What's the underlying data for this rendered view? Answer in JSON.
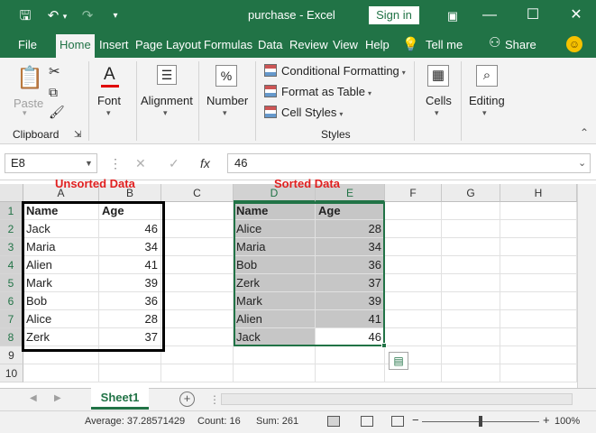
{
  "titlebar": {
    "title": "purchase  -  Excel",
    "sign_in": "Sign in",
    "icons": [
      "save-icon",
      "undo-icon",
      "redo-icon",
      "customize-icon",
      "ribbon-display-icon",
      "minimize-icon",
      "maximize-icon",
      "close-icon"
    ],
    "glyphs": {
      "save": "🖫",
      "undo": "↶",
      "undo_caret": "▾",
      "redo": "↷",
      "customize": "▾",
      "ribbon_display": "▣",
      "minimize": "—",
      "maximize": "☐",
      "close": "✕"
    }
  },
  "menu": {
    "tabs": [
      "File",
      "Home",
      "Insert",
      "Page Layout",
      "Formulas",
      "Data",
      "Review",
      "View",
      "Help"
    ],
    "active": "Home",
    "tell_me": "Tell me",
    "share": "Share",
    "glyphs": {
      "lightbulb": "💡",
      "person": "⚇",
      "smiley": "☺"
    }
  },
  "ribbon": {
    "clipboard": {
      "paste": "Paste",
      "label": "Clipboard",
      "glyphs": {
        "paste": "📋",
        "cut": "✂",
        "copy": "⧉",
        "painter": "🖌",
        "launcher": "⇲"
      }
    },
    "font": {
      "label": "Font",
      "glyph": "A"
    },
    "alignment": {
      "label": "Alignment",
      "glyph": "☰"
    },
    "number": {
      "label": "Number",
      "glyph": "%"
    },
    "styles": {
      "items": [
        "Conditional Formatting",
        "Format as Table",
        "Cell Styles"
      ],
      "label": "Styles"
    },
    "cells": {
      "label": "Cells",
      "glyph": "▦"
    },
    "editing": {
      "label": "Editing",
      "glyph": "⌕"
    },
    "collapse_glyph": "⌃"
  },
  "formula_bar": {
    "name_box": "E8",
    "value": "46",
    "glyphs": {
      "menu": "⋮",
      "cancel": "✕",
      "enter": "✓",
      "fx": "fx",
      "caret": "▼"
    }
  },
  "annotations": {
    "unsorted": "Unsorted Data",
    "sorted": "Sorted Data"
  },
  "sheet": {
    "columns": [
      "A",
      "B",
      "C",
      "D",
      "E",
      "F",
      "G",
      "H"
    ],
    "rows": [
      "1",
      "2",
      "3",
      "4",
      "5",
      "6",
      "7",
      "8",
      "9",
      "10"
    ],
    "selected_columns": [
      "D",
      "E"
    ],
    "selected_rows": [
      "1",
      "2",
      "3",
      "4",
      "5",
      "6",
      "7",
      "8"
    ],
    "active_cell": "E8",
    "unsorted": [
      [
        "Name",
        "Age"
      ],
      [
        "Jack",
        "46"
      ],
      [
        "Maria",
        "34"
      ],
      [
        "Alien",
        "41"
      ],
      [
        "Mark",
        "39"
      ],
      [
        "Bob",
        "36"
      ],
      [
        "Alice",
        "28"
      ],
      [
        "Zerk",
        "37"
      ]
    ],
    "sorted": [
      [
        "Name",
        "Age"
      ],
      [
        "Alice",
        "28"
      ],
      [
        "Maria",
        "34"
      ],
      [
        "Bob",
        "36"
      ],
      [
        "Zerk",
        "37"
      ],
      [
        "Mark",
        "39"
      ],
      [
        "Alien",
        "41"
      ],
      [
        "Jack",
        "46"
      ]
    ],
    "quick_analysis_glyph": "▤"
  },
  "tabs": {
    "sheets": [
      "Sheet1"
    ],
    "add_glyph": "+",
    "nav": {
      "prev": "◀",
      "next": "▶"
    }
  },
  "status": {
    "average": "Average: 37.28571429",
    "count": "Count: 16",
    "sum": "Sum: 261",
    "zoom": "100%",
    "zoom_level_percent": 100,
    "glyphs": {
      "minus": "−",
      "plus": "+"
    }
  },
  "colors": {
    "brand": "#217346",
    "annotation": "#e02020",
    "selection_fill": "#c6c6c6"
  }
}
